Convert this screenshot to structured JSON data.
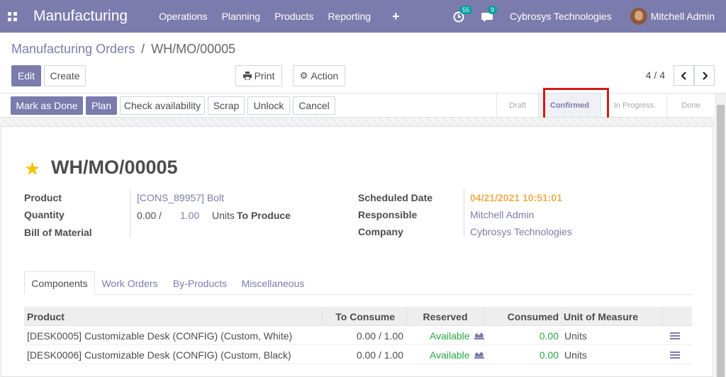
{
  "navbar": {
    "app_title": "Manufacturing",
    "menu": [
      "Operations",
      "Planning",
      "Products",
      "Reporting"
    ],
    "plus": "+",
    "activity_badge": "55",
    "message_badge": "9",
    "company": "Cybrosys Technologies",
    "user": "Mitchell Admin"
  },
  "breadcrumb": {
    "parent": "Manufacturing Orders",
    "separator": "/",
    "current": "WH/MO/00005"
  },
  "toolbar": {
    "edit": "Edit",
    "create": "Create",
    "print": "Print",
    "action": "Action",
    "pager": "4 / 4"
  },
  "statusbar": {
    "buttons": [
      "Mark as Done",
      "Plan",
      "Check availability",
      "Scrap",
      "Unlock",
      "Cancel"
    ],
    "stages": [
      "Draft",
      "Confirmed",
      "In Progress",
      "Done"
    ],
    "active_stage": "Confirmed"
  },
  "record": {
    "title": "WH/MO/00005",
    "product_label": "Product",
    "product_value": "[CONS_89957] Bolt",
    "quantity_label": "Quantity",
    "qty_produced": "0.00",
    "qty_sep": "/",
    "qty_total": "1.00",
    "qty_uom": "Units",
    "to_produce": "To Produce",
    "bom_label": "Bill of Material",
    "scheduled_label": "Scheduled Date",
    "scheduled_value": "04/21/2021 10:51:01",
    "responsible_label": "Responsible",
    "responsible_value": "Mitchell Admin",
    "company_label": "Company",
    "company_value": "Cybrosys Technologies"
  },
  "tabs": [
    "Components",
    "Work Orders",
    "By-Products",
    "Miscellaneous"
  ],
  "table": {
    "headers": [
      "Product",
      "To Consume",
      "Reserved",
      "Consumed",
      "Unit of Measure"
    ],
    "rows": [
      {
        "product": "[DESK0005] Customizable Desk (CONFIG) (Custom, White)",
        "to_consume": "0.00 / 1.00",
        "reserved": "Available",
        "consumed": "0.00",
        "uom": "Units"
      },
      {
        "product": "[DESK0006] Customizable Desk (CONFIG) (Custom, Black)",
        "to_consume": "0.00 / 1.00",
        "reserved": "Available",
        "consumed": "0.00",
        "uom": "Units"
      }
    ]
  },
  "colors": {
    "brand": "#7c7bad",
    "available": "#28a745",
    "warning_date": "#f0ad4e",
    "star": "#f3c200",
    "highlight": "#d21b1b"
  }
}
